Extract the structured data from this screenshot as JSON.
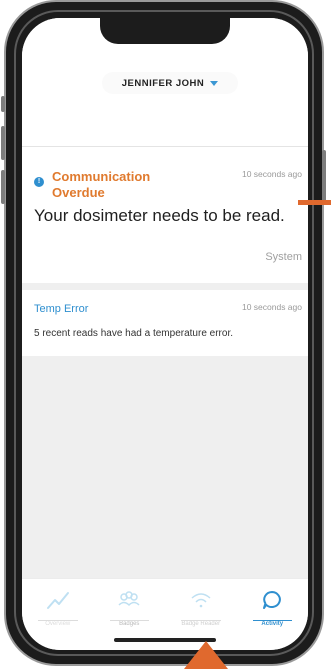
{
  "header": {
    "user_name": "JENNIFER JOHN"
  },
  "notifications": [
    {
      "title": "Communication Overdue",
      "time": "10 seconds ago",
      "message": "Your dosimeter needs to be read.",
      "source": "System",
      "title_color": "#e07a2e",
      "icon": "info-icon"
    },
    {
      "title": "Temp Error",
      "time": "10 seconds ago",
      "message": "5 recent reads have had a temperature error.",
      "title_color": "#2f8fcf"
    }
  ],
  "nav": {
    "items": [
      {
        "label": "Overview",
        "icon": "line-chart-icon",
        "active": false
      },
      {
        "label": "Badges",
        "icon": "people-group-icon",
        "active": false
      },
      {
        "label": "Badge Reader",
        "icon": "wifi-icon",
        "active": false
      },
      {
        "label": "Activity",
        "icon": "chat-bubble-icon",
        "active": true
      }
    ]
  },
  "colors": {
    "accent": "#2f8fcf",
    "alert": "#e07a2e",
    "annotation_arrow": "#e0692e"
  }
}
